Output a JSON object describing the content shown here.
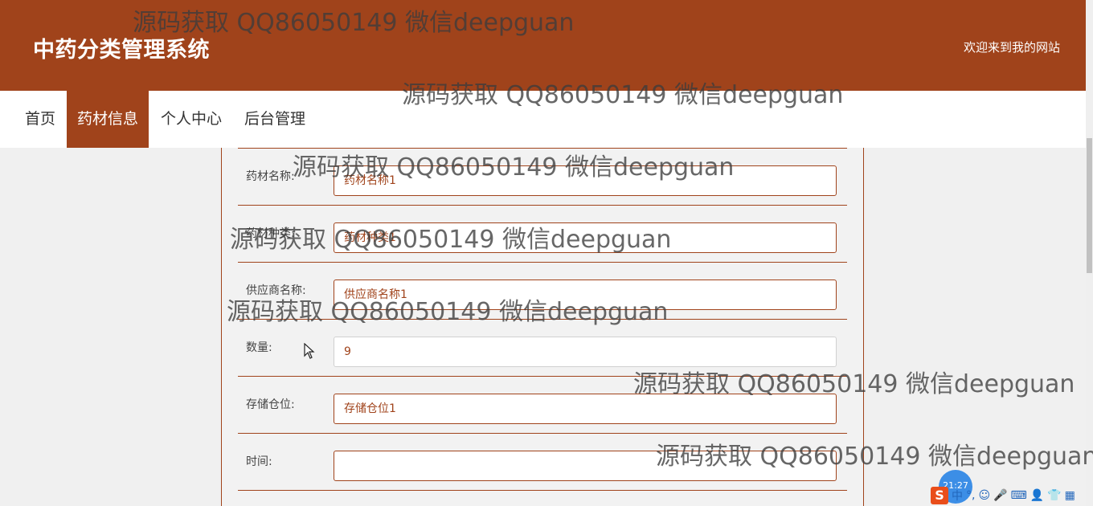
{
  "header": {
    "title": "中药分类管理系统",
    "welcome": "欢迎来到我的网站"
  },
  "nav": {
    "items": [
      {
        "label": "首页"
      },
      {
        "label": "药材信息",
        "active": true
      },
      {
        "label": "个人中心"
      },
      {
        "label": "后台管理"
      }
    ]
  },
  "form": {
    "rows": [
      {
        "label": "药材名称:",
        "value": "药材名称1"
      },
      {
        "label": "药材种类:",
        "value": "药材种类1"
      },
      {
        "label": "供应商名称:",
        "value": "供应商名称1"
      },
      {
        "label": "数量:",
        "value": "9"
      },
      {
        "label": "存储仓位:",
        "value": "存储仓位1"
      },
      {
        "label": "时间:",
        "value": ""
      }
    ]
  },
  "watermark": "源码获取 QQ86050149 微信deepguan",
  "taskbar": {
    "clock": "21:27",
    "ime_logo": "S",
    "ime_lang": "中",
    "ime_punct": "°,"
  },
  "colors": {
    "brand": "#a0431b",
    "accent": "#3c8ee6"
  }
}
